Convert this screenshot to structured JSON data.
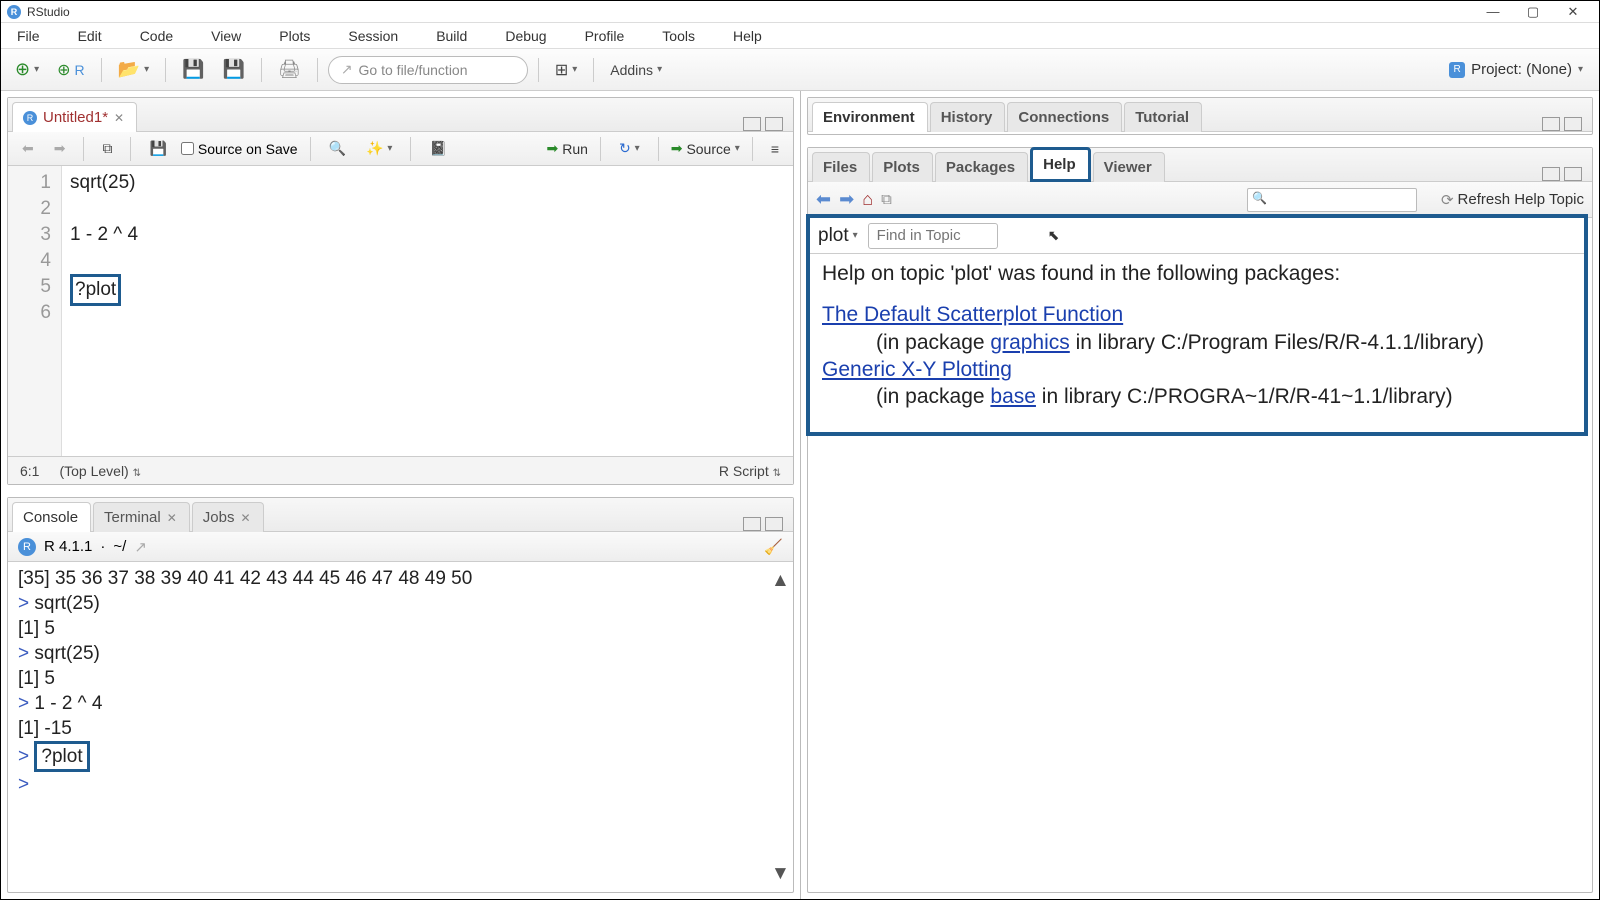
{
  "titlebar": {
    "app_name": "RStudio"
  },
  "menubar": [
    "File",
    "Edit",
    "Code",
    "View",
    "Plots",
    "Session",
    "Build",
    "Debug",
    "Profile",
    "Tools",
    "Help"
  ],
  "toolbar": {
    "goto_placeholder": "Go to file/function",
    "addins_label": "Addins",
    "project_label": "Project: (None)"
  },
  "editor": {
    "tab_title": "Untitled1*",
    "source_on_save": "Source on Save",
    "run_label": "Run",
    "source_label": "Source",
    "lines": [
      "sqrt(25)",
      "",
      "1 - 2 ^ 4",
      "",
      "?plot",
      ""
    ],
    "highlight_line_index": 4,
    "status_pos": "6:1",
    "status_scope": "(Top Level)",
    "status_type": "R Script"
  },
  "console": {
    "tabs": [
      "Console",
      "Terminal",
      "Jobs"
    ],
    "version": "R 4.1.1",
    "path": "~/",
    "lines": [
      {
        "t": "out",
        "v": "[35]  35  36  37  38  39  40  41  42  43  44  45  46  47  48  49  50"
      },
      {
        "t": "in",
        "v": "sqrt(25)"
      },
      {
        "t": "out",
        "v": "[1] 5"
      },
      {
        "t": "in",
        "v": "sqrt(25)"
      },
      {
        "t": "out",
        "v": "[1] 5"
      },
      {
        "t": "in",
        "v": "1 - 2 ^ 4"
      },
      {
        "t": "out",
        "v": "[1] -15"
      },
      {
        "t": "in_hl",
        "v": "?plot"
      },
      {
        "t": "in",
        "v": ""
      }
    ]
  },
  "right_top": {
    "tabs": [
      "Environment",
      "History",
      "Connections",
      "Tutorial"
    ]
  },
  "right_bottom": {
    "tabs": [
      "Files",
      "Plots",
      "Packages",
      "Help",
      "Viewer"
    ],
    "active_tab": "Help",
    "help": {
      "refresh_label": "Refresh Help Topic",
      "topic": "plot",
      "find_placeholder": "Find in Topic",
      "heading": "Help on topic 'plot' was found in the following packages:",
      "results": [
        {
          "title": "The Default Scatterplot Function",
          "pkg": "graphics",
          "lib": "C:/Program Files/R/R-4.1.1/library"
        },
        {
          "title": "Generic X-Y Plotting",
          "pkg": "base",
          "lib": "C:/PROGRA~1/R/R-41~1.1/library"
        }
      ]
    }
  }
}
